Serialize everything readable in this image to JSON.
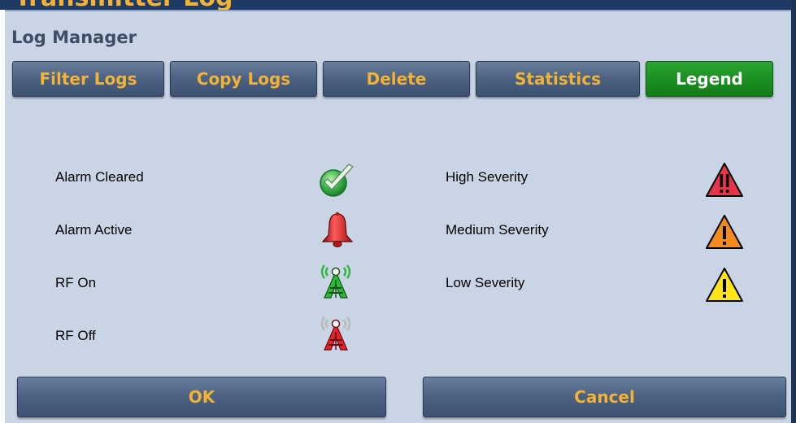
{
  "background_title": "Transmitter Log",
  "dialog": {
    "title": "Log Manager"
  },
  "tabs": [
    {
      "label": "Filter Logs",
      "active": false
    },
    {
      "label": "Copy Logs",
      "active": false
    },
    {
      "label": "Delete",
      "active": false
    },
    {
      "label": "Statistics",
      "active": false
    },
    {
      "label": "Legend",
      "active": true
    }
  ],
  "legend": {
    "left": [
      {
        "label": "Alarm Cleared",
        "icon": "check-icon"
      },
      {
        "label": "Alarm Active",
        "icon": "bell-icon"
      },
      {
        "label": "RF On",
        "icon": "rf-tower-green-icon"
      },
      {
        "label": "RF Off",
        "icon": "rf-tower-red-icon"
      }
    ],
    "right": [
      {
        "label": "High Severity",
        "icon": "warning-red-icon"
      },
      {
        "label": "Medium Severity",
        "icon": "warning-orange-icon"
      },
      {
        "label": "Low Severity",
        "icon": "warning-yellow-icon"
      }
    ]
  },
  "buttons": {
    "ok_label": "OK",
    "cancel_label": "Cancel"
  },
  "colors": {
    "dialog_bg": "#c9d5e4",
    "button_text": "#f2b233",
    "active_tab": "#1c9022",
    "severity_high": "#e8344a",
    "severity_medium": "#f28a1c",
    "severity_low": "#ffe419"
  }
}
